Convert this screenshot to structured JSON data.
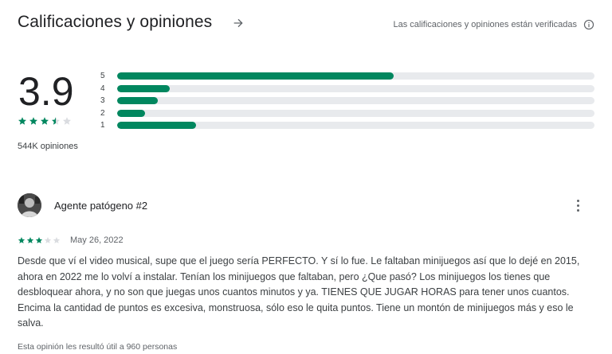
{
  "header": {
    "title": "Calificaciones y opiniones",
    "arrow_icon": "arrow-right-icon",
    "verified_text": "Las calificaciones y opiniones están verificadas",
    "info_icon": "info-icon"
  },
  "summary": {
    "rating": "3.9",
    "stars": 3.5,
    "review_count": "544K opiniones"
  },
  "histogram": [
    {
      "label": "5",
      "fraction": 0.58
    },
    {
      "label": "4",
      "fraction": 0.11
    },
    {
      "label": "3",
      "fraction": 0.085
    },
    {
      "label": "2",
      "fraction": 0.058
    },
    {
      "label": "1",
      "fraction": 0.165
    }
  ],
  "review": {
    "author": "Agente patógeno #2",
    "stars": 3,
    "date": "May 26, 2022",
    "text": "Desde que ví el video musical, supe que el juego sería PERFECTO. Y sí lo fue. Le faltaban minijuegos así que lo dejé en 2015, ahora en 2022 me lo volví a instalar. Tenían los minijuegos que faltaban, pero ¿Que pasó? Los minijuegos los tienes que desbloquear ahora, y no son que juegas unos cuantos minutos y ya. TIENES QUE JUGAR HORAS para tener unos cuantos. Encima la cantidad de puntos es excesiva, monstruosa, sólo eso le quita puntos. Tiene un montón de minijuegos más y eso le salva.",
    "helpful": "Esta opinión les resultó útil a 960 personas",
    "more_icon": "more-vert-icon"
  },
  "colors": {
    "accent": "#01875f",
    "track": "#e8eaed",
    "star_empty": "#dadce0"
  }
}
